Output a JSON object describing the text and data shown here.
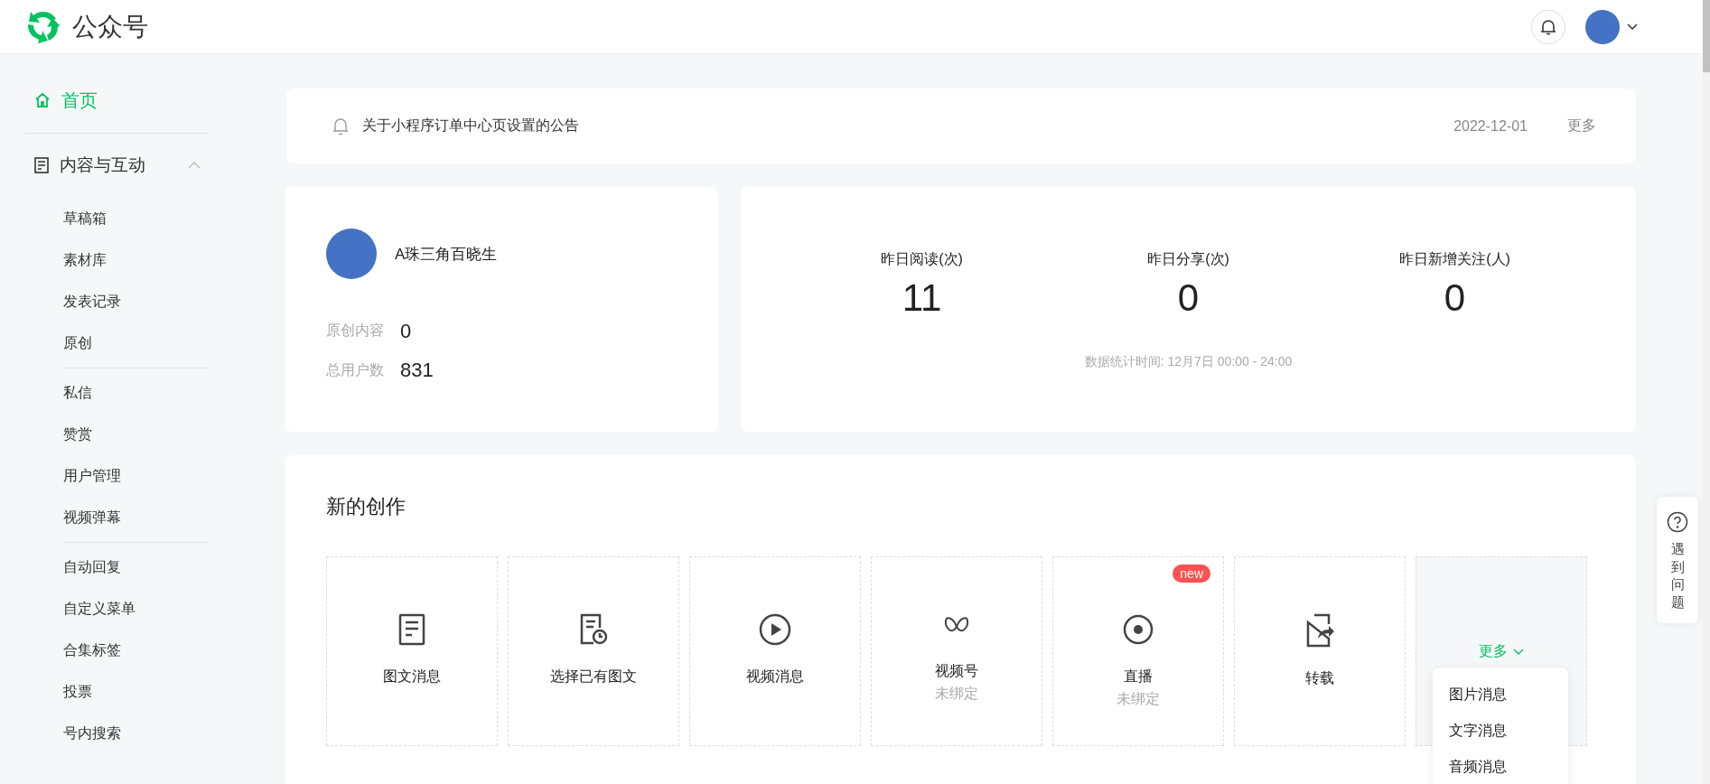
{
  "header": {
    "title": "公众号"
  },
  "sidebar": {
    "items": [
      {
        "kind": "link",
        "label": "首页",
        "selected": true
      },
      {
        "kind": "group",
        "label": "内容与互动",
        "expanded": true,
        "sections": [
          [
            "草稿箱",
            "素材库",
            "发表记录",
            "原创"
          ],
          [
            "私信",
            "赞赏",
            "用户管理",
            "视频弹幕"
          ],
          [
            "自动回复",
            "自定义菜单",
            "合集标签",
            "投票",
            "号内搜索"
          ]
        ]
      }
    ]
  },
  "notice": {
    "text": "关于小程序订单中心页设置的公告",
    "date": "2022-12-01",
    "more": "更多"
  },
  "account": {
    "name": "A珠三角百晓生",
    "stats": [
      {
        "label": "原创内容",
        "value": "0"
      },
      {
        "label": "总用户数",
        "value": "831"
      }
    ]
  },
  "yesterday": {
    "metrics": [
      {
        "label": "昨日阅读(次)",
        "value": "11"
      },
      {
        "label": "昨日分享(次)",
        "value": "0"
      },
      {
        "label": "昨日新增关注(人)",
        "value": "0"
      }
    ],
    "note": "数据统计时间: 12月7日 00:00 - 24:00"
  },
  "creation": {
    "title": "新的创作",
    "tiles": [
      {
        "kind": "article",
        "label": "图文消息"
      },
      {
        "kind": "history",
        "label": "选择已有图文"
      },
      {
        "kind": "video",
        "label": "视频消息"
      },
      {
        "kind": "channels",
        "label": "视频号",
        "sub": "未绑定"
      },
      {
        "kind": "live",
        "label": "直播",
        "sub": "未绑定",
        "badge": "new"
      },
      {
        "kind": "repost",
        "label": "转载"
      }
    ],
    "more": {
      "label": "更多",
      "open": true,
      "menu": [
        "图片消息",
        "文字消息",
        "音频消息"
      ]
    }
  },
  "help": {
    "label": "遇到问题"
  }
}
